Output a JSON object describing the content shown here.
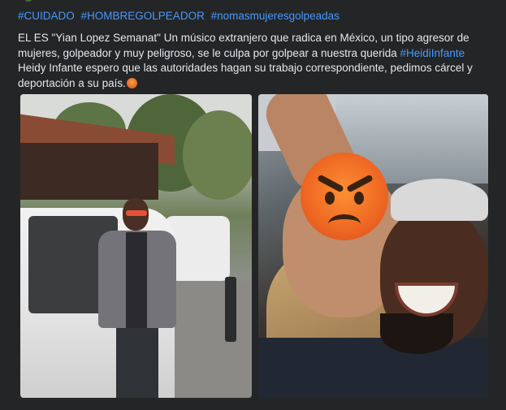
{
  "post": {
    "hashtags": [
      "#CUIDADO",
      "#HOMBREGOLPEADOR",
      "#nomasmujeresgolpeadas"
    ],
    "text_part1": "EL ES \"Yian Lopez Semanat\" Un músico extranjero que radica en México, un tipo agresor de mujeres, golpeador y muy peligroso, se le culpa por golpear a nuestra querida ",
    "mention": "#HeidiInfante",
    "text_part2": " Heidy Infante  espero que las autoridades hagan su trabajo correspondiente, pedimos cárcel y deportación a su país.",
    "emoji_name": "angry-face-emoji",
    "photos": [
      {
        "name": "photo-man-with-car"
      },
      {
        "name": "photo-selfie-with-angry-emoji-cover"
      }
    ]
  },
  "colors": {
    "background": "#242526",
    "text": "#e4e6eb",
    "link": "#4599ff"
  }
}
